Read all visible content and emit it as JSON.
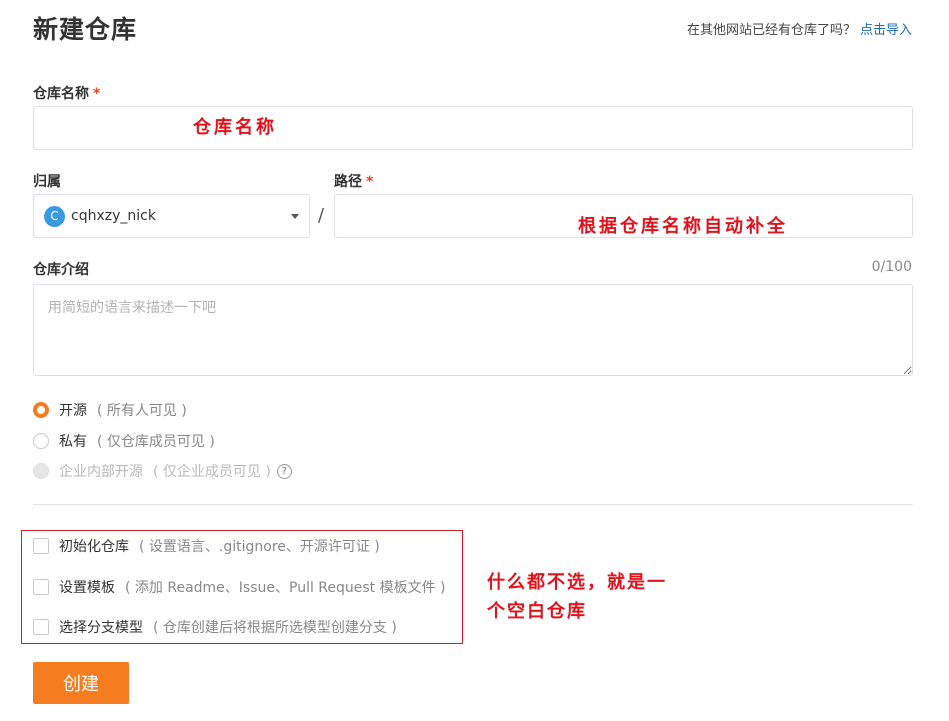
{
  "page": {
    "title": "新建仓库",
    "import_hint": "在其他网站已经有仓库了吗？",
    "import_link": "点击导入"
  },
  "repo_name": {
    "label": "仓库名称",
    "required_mark": "*",
    "value": "",
    "annotation": "仓库名称"
  },
  "owner": {
    "label": "归属",
    "avatar_letter": "C",
    "selected": "cqhxzy_nick",
    "separator": "/"
  },
  "path": {
    "label": "路径",
    "required_mark": "*",
    "value": "",
    "annotation": "根据仓库名称自动补全"
  },
  "description": {
    "label": "仓库介绍",
    "counter": "0/100",
    "placeholder": "用简短的语言来描述一下吧",
    "value": ""
  },
  "visibility": {
    "options": [
      {
        "label": "开源",
        "hint": "( 所有人可见 )",
        "checked": true,
        "disabled": false
      },
      {
        "label": "私有",
        "hint": "( 仅仓库成员可见 )",
        "checked": false,
        "disabled": false
      },
      {
        "label": "企业内部开源",
        "hint": "( 仅企业成员可见 )",
        "checked": false,
        "disabled": true,
        "help_icon": "?"
      }
    ]
  },
  "init_options": [
    {
      "label": "初始化仓库",
      "hint": "( 设置语言、.gitignore、开源许可证 )",
      "checked": false
    },
    {
      "label": "设置模板",
      "hint": "( 添加 Readme、Issue、Pull Request 模板文件 )",
      "checked": false
    },
    {
      "label": "选择分支模型",
      "hint": "( 仓库创建后将根据所选模型创建分支 )",
      "checked": false
    }
  ],
  "annotation_side": {
    "line1": "什么都不选，就是一",
    "line2": "个空白仓库"
  },
  "create_button": {
    "label": "创建"
  },
  "colors": {
    "accent": "#f57c1f",
    "link": "#1b6fa8",
    "annotation": "#e0121b"
  },
  "icons": {
    "owner_dropdown": "caret-down-icon",
    "help": "question-circle-icon"
  }
}
